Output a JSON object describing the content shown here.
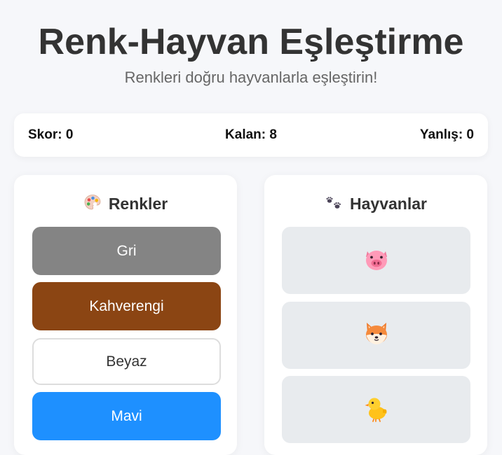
{
  "header": {
    "title": "Renk-Hayvan Eşleştirme",
    "subtitle": "Renkleri doğru hayvanlarla eşleştirin!"
  },
  "stats": {
    "score": "Skor: 0",
    "remaining": "Kalan: 8",
    "wrong": "Yanlış: 0"
  },
  "colors_panel": {
    "title": "Renkler",
    "icon": "palette-icon",
    "items": [
      {
        "label": "Gri",
        "color": "#848484",
        "text_color": "#ffffff"
      },
      {
        "label": "Kahverengi",
        "color": "#8b4513",
        "text_color": "#ffffff"
      },
      {
        "label": "Beyaz",
        "color": "#ffffff",
        "text_color": "#333333"
      },
      {
        "label": "Mavi",
        "color": "#1e90ff",
        "text_color": "#ffffff"
      }
    ]
  },
  "animals_panel": {
    "title": "Hayvanlar",
    "icon": "paw-prints-icon",
    "items": [
      {
        "icon": "pig-face-icon"
      },
      {
        "icon": "fox-face-icon"
      },
      {
        "icon": "chick-icon"
      }
    ]
  }
}
